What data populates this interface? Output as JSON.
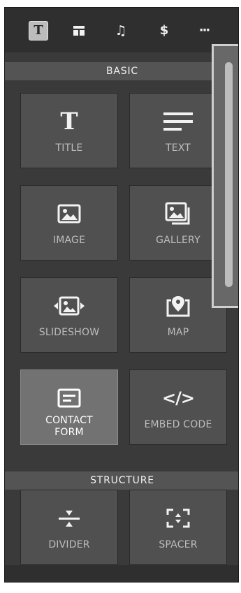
{
  "toolbar": {
    "items": [
      {
        "name": "title-tab",
        "icon": "title-t-icon",
        "glyph": "T",
        "active": true
      },
      {
        "name": "layout-tab",
        "icon": "layout-icon",
        "glyph": "",
        "active": false
      },
      {
        "name": "music-tab",
        "icon": "music-note-icon",
        "glyph": "♫",
        "active": false
      },
      {
        "name": "commerce-tab",
        "icon": "dollar-icon",
        "glyph": "$",
        "active": false
      },
      {
        "name": "more-tab",
        "icon": "more-dots-icon",
        "glyph": "···",
        "active": false
      }
    ]
  },
  "sections": {
    "basic": {
      "label": "BASIC"
    },
    "structure": {
      "label": "STRUCTURE"
    }
  },
  "blocks": {
    "title": {
      "label": "TITLE",
      "icon": "title-t-icon"
    },
    "text": {
      "label": "TEXT",
      "icon": "text-lines-icon"
    },
    "image": {
      "label": "IMAGE",
      "icon": "image-icon"
    },
    "gallery": {
      "label": "GALLERY",
      "icon": "gallery-icon"
    },
    "slideshow": {
      "label": "SLIDESHOW",
      "icon": "slideshow-icon"
    },
    "map": {
      "label": "MAP",
      "icon": "map-pin-icon"
    },
    "contact_form": {
      "label": "CONTACT FORM",
      "icon": "contact-form-icon",
      "selected": true
    },
    "embed_code": {
      "label": "EMBED CODE",
      "icon": "embed-code-icon"
    },
    "divider": {
      "label": "DIVIDER",
      "icon": "divider-icon"
    },
    "spacer": {
      "label": "SPACER",
      "icon": "spacer-icon"
    }
  },
  "colors": {
    "panel_bg": "#3a3a3a",
    "tile_bg": "#505050",
    "tile_selected_bg": "#727272",
    "section_header_bg": "#545454",
    "text_light": "#f2f2f2",
    "label_gray": "#bdbdbd"
  }
}
